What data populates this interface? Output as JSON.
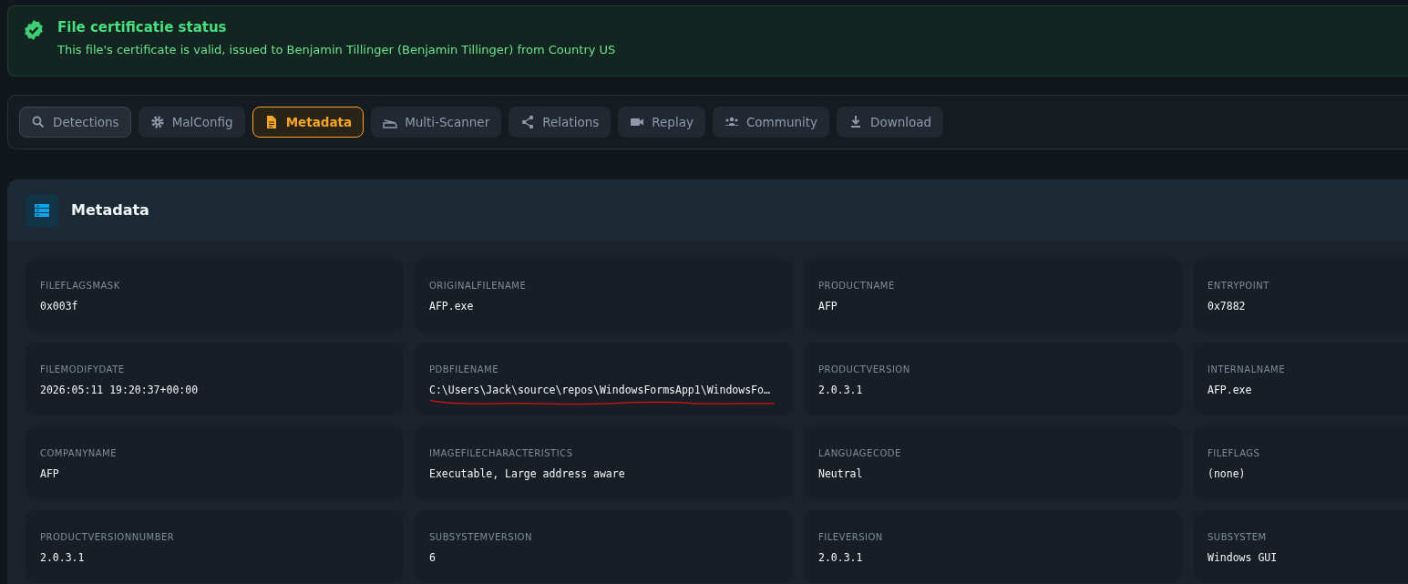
{
  "certificate_banner": {
    "title": "File certificatie status",
    "message": "This file's certificate is valid, issued to Benjamin Tillinger (Benjamin Tillinger) from Country US"
  },
  "tabs": [
    {
      "label": "Detections",
      "selected": false,
      "outlined": true
    },
    {
      "label": "MalConfig",
      "selected": false,
      "outlined": false
    },
    {
      "label": "Metadata",
      "selected": true,
      "outlined": false
    },
    {
      "label": "Multi-Scanner",
      "selected": false,
      "outlined": false
    },
    {
      "label": "Relations",
      "selected": false,
      "outlined": false
    },
    {
      "label": "Replay",
      "selected": false,
      "outlined": false
    },
    {
      "label": "Community",
      "selected": false,
      "outlined": false
    },
    {
      "label": "Download",
      "selected": false,
      "outlined": false
    }
  ],
  "metadata_panel": {
    "title": "Metadata",
    "fields": [
      {
        "label": "FILEFLAGSMASK",
        "value": "0x003f",
        "underlined": false
      },
      {
        "label": "ORIGINALFILENAME",
        "value": "AFP.exe",
        "underlined": false
      },
      {
        "label": "PRODUCTNAME",
        "value": "AFP",
        "underlined": false
      },
      {
        "label": "ENTRYPOINT",
        "value": "0x7882",
        "underlined": false
      },
      {
        "label": "FILEMODIFYDATE",
        "value": "2026:05:11 19:20:37+00:00",
        "underlined": false
      },
      {
        "label": "PDBFILENAME",
        "value": "C:\\Users\\Jack\\source\\repos\\WindowsFormsApp1\\WindowsFo…",
        "underlined": true
      },
      {
        "label": "PRODUCTVERSION",
        "value": "2.0.3.1",
        "underlined": false
      },
      {
        "label": "INTERNALNAME",
        "value": "AFP.exe",
        "underlined": false
      },
      {
        "label": "COMPANYNAME",
        "value": "AFP",
        "underlined": false
      },
      {
        "label": "IMAGEFILECHARACTERISTICS",
        "value": "Executable, Large address aware",
        "underlined": false
      },
      {
        "label": "LANGUAGECODE",
        "value": "Neutral",
        "underlined": false
      },
      {
        "label": "FILEFLAGS",
        "value": "(none)",
        "underlined": false
      },
      {
        "label": "PRODUCTVERSIONNUMBER",
        "value": "2.0.3.1",
        "underlined": false
      },
      {
        "label": "SUBSYSTEMVERSION",
        "value": "6",
        "underlined": false
      },
      {
        "label": "FILEVERSION",
        "value": "2.0.3.1",
        "underlined": false
      },
      {
        "label": "SUBSYSTEM",
        "value": "Windows GUI",
        "underlined": false
      }
    ]
  }
}
